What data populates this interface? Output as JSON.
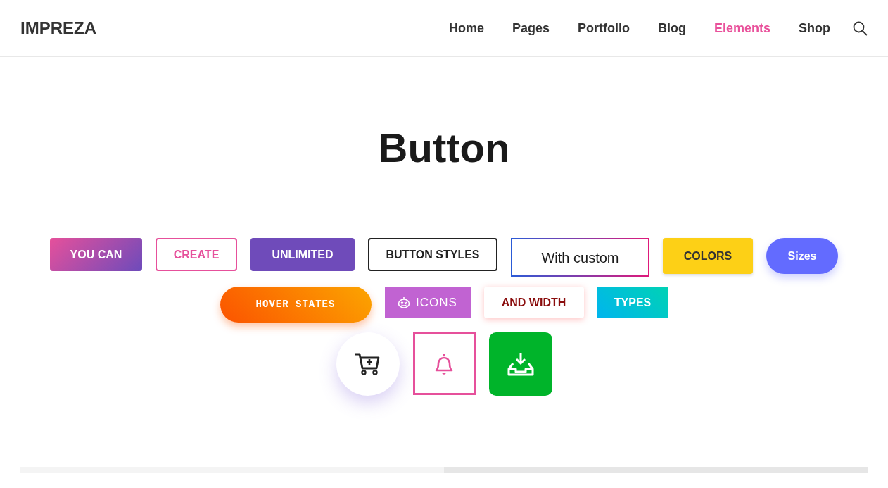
{
  "header": {
    "logo": "IMPREZA",
    "nav": [
      {
        "label": "Home",
        "selected": false
      },
      {
        "label": "Pages",
        "selected": false
      },
      {
        "label": "Portfolio",
        "selected": false
      },
      {
        "label": "Blog",
        "selected": false
      },
      {
        "label": "Elements",
        "selected": true
      },
      {
        "label": "Shop",
        "selected": false
      }
    ]
  },
  "page_title": "Button",
  "button_rows": [
    [
      {
        "label": "YOU CAN",
        "kind": "gradient-pink"
      },
      {
        "label": "CREATE",
        "kind": "outline-pink"
      },
      {
        "label": "UNLIMITED",
        "kind": "solid-purple"
      },
      {
        "label": "BUTTON STYLES",
        "kind": "outline-dark"
      },
      {
        "label": "With custom",
        "kind": "gradient-border"
      },
      {
        "label": "COLORS",
        "kind": "solid-yellow"
      },
      {
        "label": "Sizes",
        "kind": "pill-blue"
      }
    ],
    [
      {
        "label": "HOVER STATES",
        "kind": "pill-orange"
      },
      {
        "label": "ICONS",
        "kind": "solid-violet"
      },
      {
        "label": "AND WIDTH",
        "kind": "shadow-white"
      },
      {
        "label": "TYPES",
        "kind": "gradient-teal"
      }
    ]
  ],
  "icon_buttons": [
    {
      "kind": "cart"
    },
    {
      "kind": "bell"
    },
    {
      "kind": "download"
    }
  ]
}
